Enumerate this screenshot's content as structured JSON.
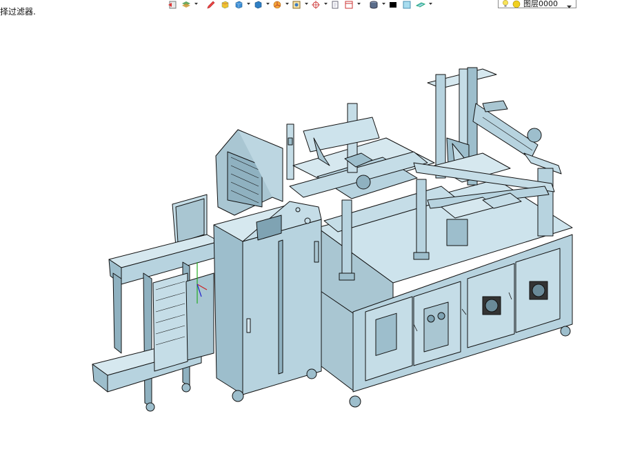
{
  "status": {
    "hint": "择过滤器."
  },
  "toolbar": {
    "items": [
      "undo-icon",
      "layers-icon",
      "pencil-icon",
      "cube-yellow-icon",
      "cube-blue-icon",
      "cube-view-icon",
      "pie-icon",
      "frame-icon",
      "crosshair-icon",
      "page-icon",
      "sheet-icon",
      "cylinder-icon",
      "color-black-icon",
      "color-cyan-icon",
      "plane-icon"
    ]
  },
  "layer": {
    "current": "图层0000"
  },
  "colors": {
    "model_fill": "#b7d3df",
    "model_dark": "#8fb1c0",
    "model_light": "#d6e8ef",
    "edge": "#111111",
    "background": "#ffffff"
  }
}
